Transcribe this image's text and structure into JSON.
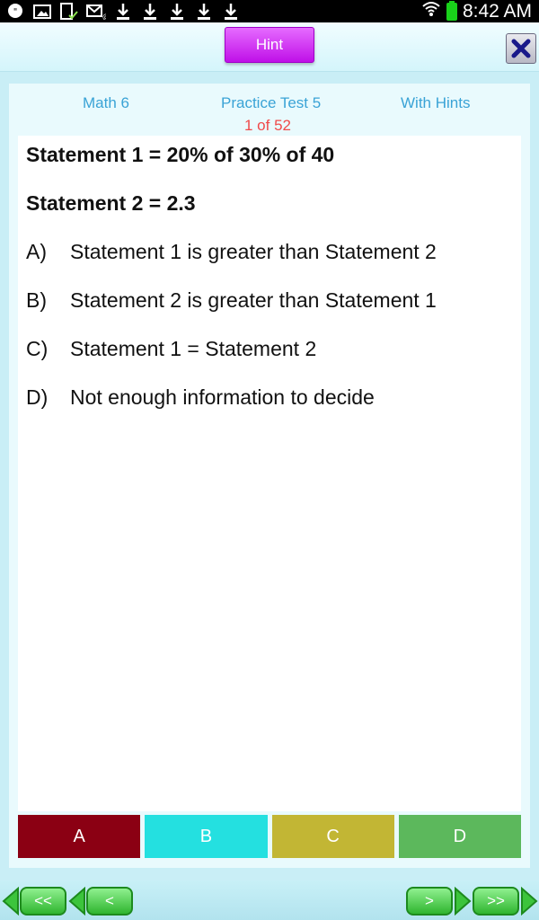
{
  "status_bar": {
    "time": "8:42 AM",
    "icons": [
      "hangouts-icon",
      "gallery-icon",
      "document-check-icon",
      "email-icon",
      "download-icon",
      "download-icon",
      "download-icon",
      "download-icon",
      "download-icon",
      "wifi-icon",
      "battery-icon"
    ]
  },
  "toolbar": {
    "hint_label": "Hint",
    "close_icon": "close-x-icon"
  },
  "header": {
    "subject": "Math 6",
    "test_name": "Practice Test 5",
    "mode": "With Hints",
    "counter": "1 of 52"
  },
  "question": {
    "statement1": "Statement 1 = 20% of 30% of 40",
    "statement2": "Statement 2 = 2.3",
    "options": [
      {
        "letter": "A)",
        "text": "Statement  1 is greater than Statement 2"
      },
      {
        "letter": "B)",
        "text": "Statement  2 is greater than Statement 1"
      },
      {
        "letter": "C)",
        "text": "Statement 1 = Statement 2"
      },
      {
        "letter": "D)",
        "text": "Not enough information to decide"
      }
    ]
  },
  "answers": [
    {
      "label": "A",
      "color": "#8b0013"
    },
    {
      "label": "B",
      "color": "#24e0e0"
    },
    {
      "label": "C",
      "color": "#c2b634"
    },
    {
      "label": "D",
      "color": "#5cb85c"
    }
  ],
  "nav": {
    "first_label": "<<",
    "prev_label": "<",
    "next_label": ">",
    "last_label": ">>"
  },
  "colors": {
    "hint_accent": "#cc33ee",
    "header_text": "#3aa3d6",
    "counter_text": "#f04a4a",
    "nav_green": "#3cc43c"
  }
}
